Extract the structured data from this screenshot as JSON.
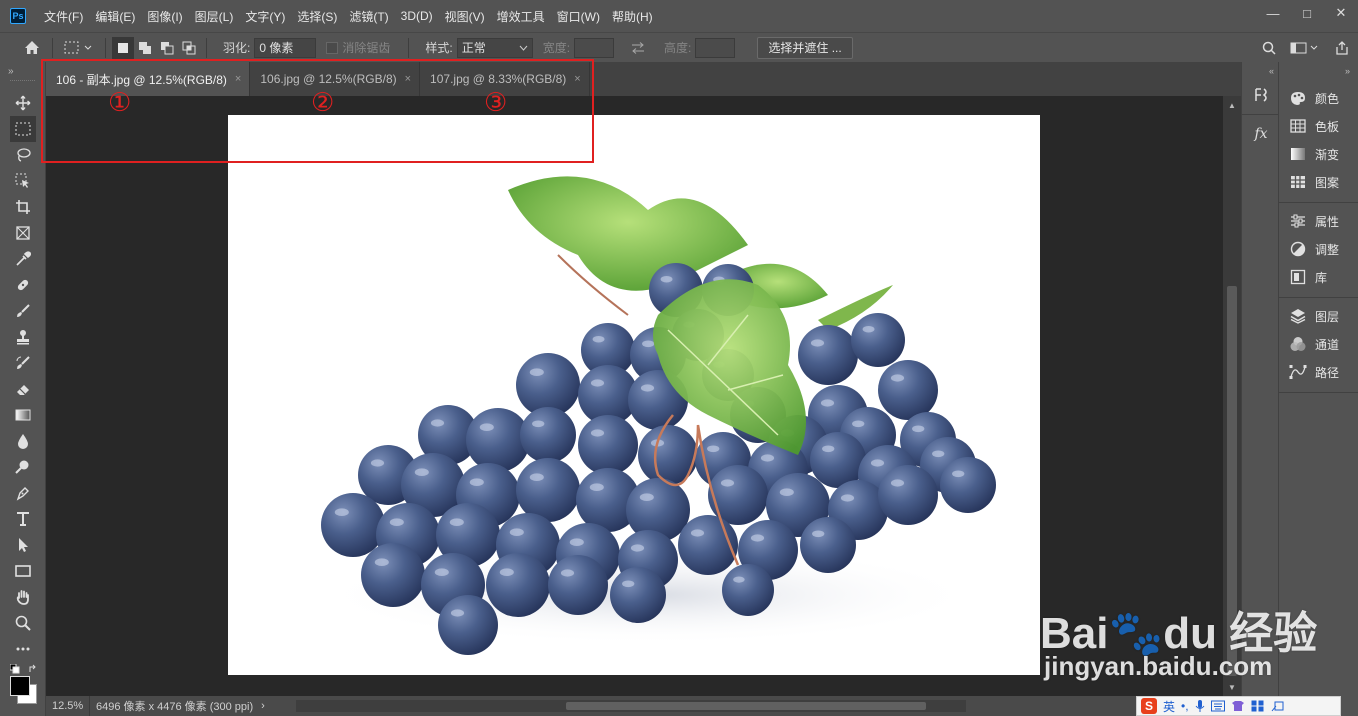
{
  "app": {
    "logo_text": "Ps",
    "menu": [
      "文件(F)",
      "编辑(E)",
      "图像(I)",
      "图层(L)",
      "文字(Y)",
      "选择(S)",
      "滤镜(T)",
      "3D(D)",
      "视图(V)",
      "增效工具",
      "窗口(W)",
      "帮助(H)"
    ],
    "window_controls": {
      "minimize": "—",
      "restore": "□",
      "close": "✕"
    }
  },
  "options": {
    "feather_label": "羽化:",
    "feather_value": "0 像素",
    "antialias_label": "消除锯齿",
    "style_label": "样式:",
    "style_value": "正常",
    "width_label": "宽度:",
    "height_label": "高度:",
    "select_mask_label": "选择并遮住 ..."
  },
  "tabs": [
    {
      "label": "106 - 副本.jpg @ 12.5%(RGB/8)",
      "active": true
    },
    {
      "label": "106.jpg @ 12.5%(RGB/8)",
      "active": false
    },
    {
      "label": "107.jpg @ 8.33%(RGB/8)",
      "active": false
    }
  ],
  "tab_close": "×",
  "status": {
    "zoom": "12.5%",
    "doc_info": "6496 像素 x 4476 像素 (300 ppi)",
    "arrow": "›"
  },
  "right_panel": {
    "groups": [
      [
        {
          "label": "颜色",
          "icon": "palette-icon"
        },
        {
          "label": "色板",
          "icon": "swatches-icon"
        },
        {
          "label": "渐变",
          "icon": "gradient-icon"
        },
        {
          "label": "图案",
          "icon": "pattern-icon"
        }
      ],
      [
        {
          "label": "属性",
          "icon": "properties-icon"
        },
        {
          "label": "调整",
          "icon": "adjustments-icon"
        },
        {
          "label": "库",
          "icon": "libraries-icon"
        }
      ],
      [
        {
          "label": "图层",
          "icon": "layers-icon"
        },
        {
          "label": "通道",
          "icon": "channels-icon"
        },
        {
          "label": "路径",
          "icon": "paths-icon"
        }
      ]
    ]
  },
  "mini_panel": {
    "fx_label": "fx"
  },
  "annotations": [
    "①",
    "②",
    "③"
  ],
  "watermark": {
    "big": "Bai🐾du 经验",
    "small": "jingyan.baidu.com"
  },
  "ime": {
    "logo": "S",
    "mode": "英",
    "punct": "•,"
  },
  "colors": {
    "accent_red": "#e02020",
    "ps_blue": "#31a8ff",
    "grape": "#3f5580",
    "leaf": "#6fae3a"
  }
}
